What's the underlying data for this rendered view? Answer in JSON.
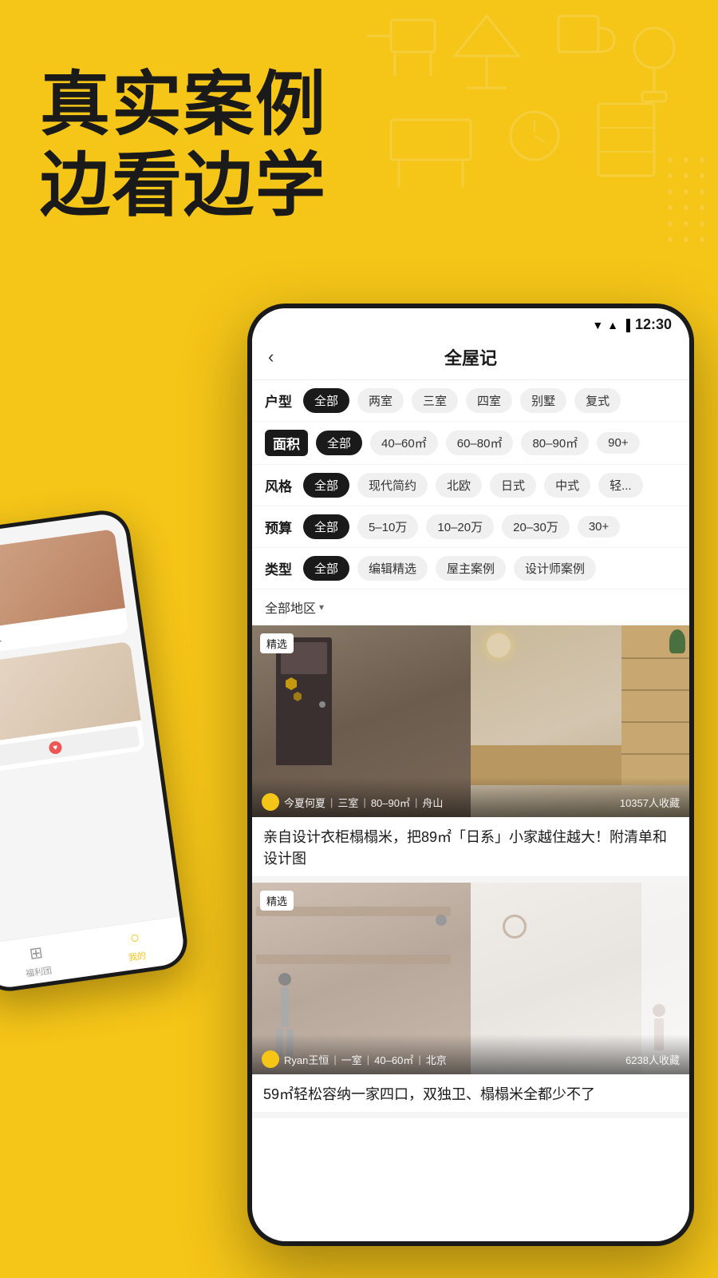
{
  "hero": {
    "line1": "真实案例",
    "line2": "边看边学"
  },
  "status_bar": {
    "time": "12:30",
    "icons": [
      "wifi",
      "signal",
      "battery"
    ]
  },
  "app_header": {
    "back_label": "‹",
    "title": "全屋记"
  },
  "filters": {
    "rows": [
      {
        "label": "户型",
        "tags": [
          "全部",
          "两室",
          "三室",
          "四室",
          "别墅",
          "复式"
        ],
        "active_index": 0
      },
      {
        "label": "面积",
        "tags": [
          "全部",
          "40–60㎡",
          "60–80㎡",
          "80–90㎡",
          "90+"
        ],
        "active_index": 0,
        "label_active": true
      },
      {
        "label": "风格",
        "tags": [
          "全部",
          "现代简约",
          "北欧",
          "日式",
          "中式",
          "轻..."
        ],
        "active_index": 0
      },
      {
        "label": "预算",
        "tags": [
          "全部",
          "5–10万",
          "10–20万",
          "20–30万",
          "30+"
        ],
        "active_index": 0
      },
      {
        "label": "类型",
        "tags": [
          "全部",
          "编辑精选",
          "屋主案例",
          "设计师案例"
        ],
        "active_index": 0
      }
    ],
    "region": "全部地区",
    "region_arrow": "▾"
  },
  "cards": [
    {
      "badge": "精选",
      "author": "今夏何夏",
      "room_type": "三室",
      "area": "80–90㎡",
      "city": "舟山",
      "saves": "10357人收藏",
      "title": "亲自设计衣柜榻榻米，把89㎡「日系」小家越住越大！附清单和设计图"
    },
    {
      "badge": "精选",
      "author": "Ryan王恒",
      "room_type": "一室",
      "area": "40–60㎡",
      "city": "北京",
      "saves": "6238人收藏",
      "title": "59㎡轻松容纳一家四口，双独卫、榻榻米全都少不了"
    }
  ],
  "phone2": {
    "nav_items": [
      {
        "icon": "⊞",
        "label": "福利团"
      },
      {
        "icon": "○",
        "label": "我的"
      }
    ]
  }
}
